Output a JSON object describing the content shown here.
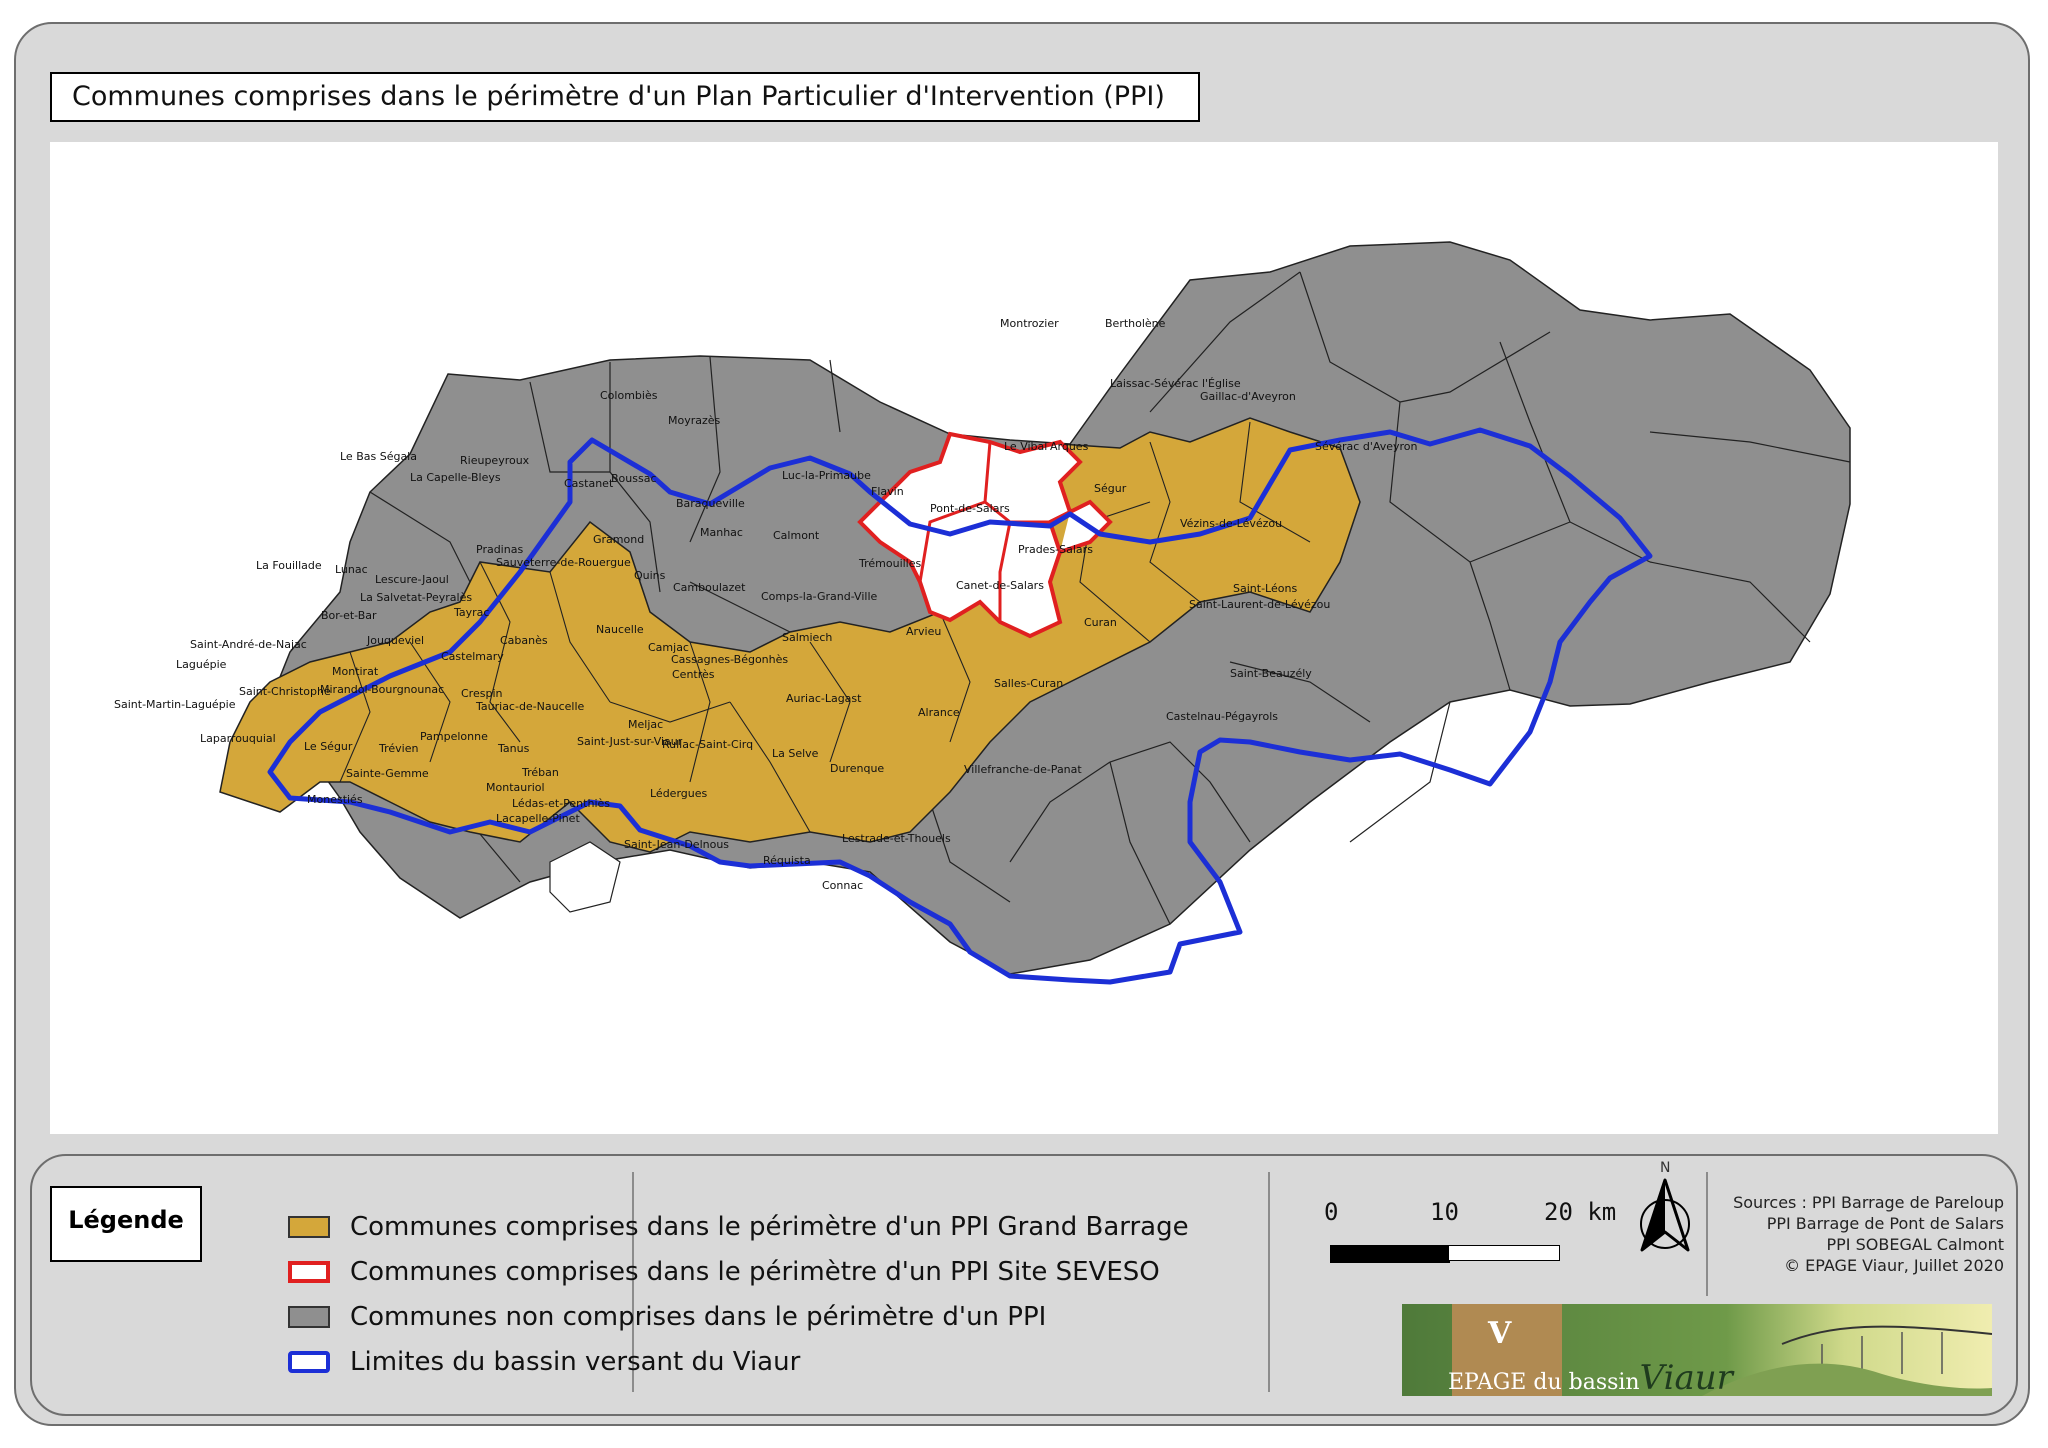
{
  "title": "Communes comprises dans le périmètre d'un Plan Particulier d'Intervention (PPI)",
  "colors": {
    "grand_barrage": "#d4a73a",
    "seveso_outline": "#e02020",
    "non_comprise": "#8f8f8f",
    "bassin_limit": "#1c2fd6",
    "commune_border": "#222222"
  },
  "communes": [
    {
      "name": "Montrozier",
      "status": "non_comprise"
    },
    {
      "name": "Bertholène",
      "status": "non_comprise"
    },
    {
      "name": "Laissac-Sévérac l'Église",
      "status": "non_comprise"
    },
    {
      "name": "Gaillac-d'Aveyron",
      "status": "non_comprise"
    },
    {
      "name": "Sévérac d'Aveyron",
      "status": "non_comprise"
    },
    {
      "name": "Colombiès",
      "status": "non_comprise"
    },
    {
      "name": "Moyrazès",
      "status": "non_comprise"
    },
    {
      "name": "Le Bas Ségala",
      "status": "non_comprise"
    },
    {
      "name": "Rieupeyroux",
      "status": "non_comprise"
    },
    {
      "name": "La Capelle-Bleys",
      "status": "non_comprise"
    },
    {
      "name": "Castanet",
      "status": "non_comprise"
    },
    {
      "name": "Boussac",
      "status": "non_comprise"
    },
    {
      "name": "Luc-la-Primaube",
      "status": "seveso"
    },
    {
      "name": "Flavin",
      "status": "grand_barrage"
    },
    {
      "name": "Le Vibal",
      "status": "non_comprise"
    },
    {
      "name": "Arques",
      "status": "non_comprise"
    },
    {
      "name": "Baraqueville",
      "status": "seveso"
    },
    {
      "name": "Pont-de-Salars",
      "status": "grand_barrage"
    },
    {
      "name": "Ségur",
      "status": "non_comprise"
    },
    {
      "name": "Manhac",
      "status": "seveso"
    },
    {
      "name": "Calmont",
      "status": "seveso"
    },
    {
      "name": "Gramond",
      "status": "non_comprise"
    },
    {
      "name": "Vézins-de-Lévézou",
      "status": "non_comprise"
    },
    {
      "name": "Pradinas",
      "status": "non_comprise"
    },
    {
      "name": "Sauveterre-de-Rouergue",
      "status": "non_comprise"
    },
    {
      "name": "Prades-Salars",
      "status": "non_comprise"
    },
    {
      "name": "La Fouillade",
      "status": "non_comprise"
    },
    {
      "name": "Lunac",
      "status": "non_comprise"
    },
    {
      "name": "Quins",
      "status": "non_comprise"
    },
    {
      "name": "Trémouilles",
      "status": "grand_barrage"
    },
    {
      "name": "Lescure-Jaoul",
      "status": "grand_barrage"
    },
    {
      "name": "Camboulazet",
      "status": "grand_barrage"
    },
    {
      "name": "Canet-de-Salars",
      "status": "grand_barrage"
    },
    {
      "name": "La Salvetat-Peyralès",
      "status": "grand_barrage"
    },
    {
      "name": "Saint-Léons",
      "status": "non_comprise"
    },
    {
      "name": "Comps-la-Grand-Ville",
      "status": "grand_barrage"
    },
    {
      "name": "Bor-et-Bar",
      "status": "grand_barrage"
    },
    {
      "name": "Tayrac",
      "status": "non_comprise"
    },
    {
      "name": "Saint-Laurent-de-Lévézou",
      "status": "non_comprise"
    },
    {
      "name": "Curan",
      "status": "non_comprise"
    },
    {
      "name": "Naucelle",
      "status": "non_comprise"
    },
    {
      "name": "Arvieu",
      "status": "grand_barrage"
    },
    {
      "name": "Cabanès",
      "status": "non_comprise"
    },
    {
      "name": "Saint-André-de-Najac",
      "status": "grand_barrage"
    },
    {
      "name": "Jouqueviel",
      "status": "grand_barrage"
    },
    {
      "name": "Camjac",
      "status": "grand_barrage"
    },
    {
      "name": "Salmiech",
      "status": "grand_barrage"
    },
    {
      "name": "Castelmary",
      "status": "grand_barrage"
    },
    {
      "name": "Cassagnes-Bégonhès",
      "status": "grand_barrage"
    },
    {
      "name": "Laguépie",
      "status": "grand_barrage"
    },
    {
      "name": "Montirat",
      "status": "grand_barrage"
    },
    {
      "name": "Centrès",
      "status": "grand_barrage"
    },
    {
      "name": "Saint-Beauzély",
      "status": "non_comprise"
    },
    {
      "name": "Salles-Curan",
      "status": "non_comprise"
    },
    {
      "name": "Saint-Christophe",
      "status": "grand_barrage"
    },
    {
      "name": "Mirandol-Bourgnounac",
      "status": "grand_barrage"
    },
    {
      "name": "Crespin",
      "status": "grand_barrage"
    },
    {
      "name": "Auriac-Lagast",
      "status": "non_comprise"
    },
    {
      "name": "Saint-Martin-Laguépie",
      "status": "grand_barrage"
    },
    {
      "name": "Tauriac-de-Naucelle",
      "status": "grand_barrage"
    },
    {
      "name": "Alrance",
      "status": "non_comprise"
    },
    {
      "name": "Castelnau-Pégayrols",
      "status": "non_comprise"
    },
    {
      "name": "Meljac",
      "status": "non_comprise"
    },
    {
      "name": "Laparrouquial",
      "status": "grand_barrage"
    },
    {
      "name": "Le Ségur",
      "status": "grand_barrage"
    },
    {
      "name": "Pampelonne",
      "status": "grand_barrage"
    },
    {
      "name": "Tanus",
      "status": "grand_barrage"
    },
    {
      "name": "Saint-Just-sur-Viaur",
      "status": "grand_barrage"
    },
    {
      "name": "Rullac-Saint-Cirq",
      "status": "non_comprise"
    },
    {
      "name": "Trévien",
      "status": "non_comprise"
    },
    {
      "name": "La Selve",
      "status": "non_comprise"
    },
    {
      "name": "Durenque",
      "status": "non_comprise"
    },
    {
      "name": "Sainte-Gemme",
      "status": "non_comprise"
    },
    {
      "name": "Villefranche-de-Panat",
      "status": "non_comprise"
    },
    {
      "name": "Tréban",
      "status": "grand_barrage"
    },
    {
      "name": "Montauriol",
      "status": "non_comprise"
    },
    {
      "name": "Monestiés",
      "status": "non_comprise"
    },
    {
      "name": "Lédergues",
      "status": "non_comprise"
    },
    {
      "name": "Lédas-et-Penthiès",
      "status": "non_comprise"
    },
    {
      "name": "Lacapelle-Pinet",
      "status": "non_comprise"
    },
    {
      "name": "Lestrade-et-Thouels",
      "status": "non_comprise"
    },
    {
      "name": "Saint-Jean-Delnous",
      "status": "non_comprise"
    },
    {
      "name": "Réquista",
      "status": "non_comprise"
    },
    {
      "name": "Connac",
      "status": "non_comprise"
    }
  ],
  "legend": {
    "title": "Légende",
    "items": [
      {
        "label": "Communes comprises dans le périmètre d'un PPI Grand Barrage"
      },
      {
        "label": "Communes comprises dans le périmètre d'un PPI Site SEVESO"
      },
      {
        "label": "Communes non comprises dans le périmètre d'un PPI"
      },
      {
        "label": "Limites du bassin versant du Viaur"
      }
    ]
  },
  "scale": {
    "ticks": [
      "0",
      "10",
      "20 km"
    ]
  },
  "north_label": "N",
  "sources": [
    "Sources : PPI Barrage de Pareloup",
    "PPI Barrage de Pont de Salars",
    "PPI SOBEGAL Calmont",
    "© EPAGE Viaur, Juillet 2020"
  ],
  "logo": {
    "text_small": "EPAGE",
    "text_mid": "du bassin",
    "text_big": "Viaur"
  }
}
